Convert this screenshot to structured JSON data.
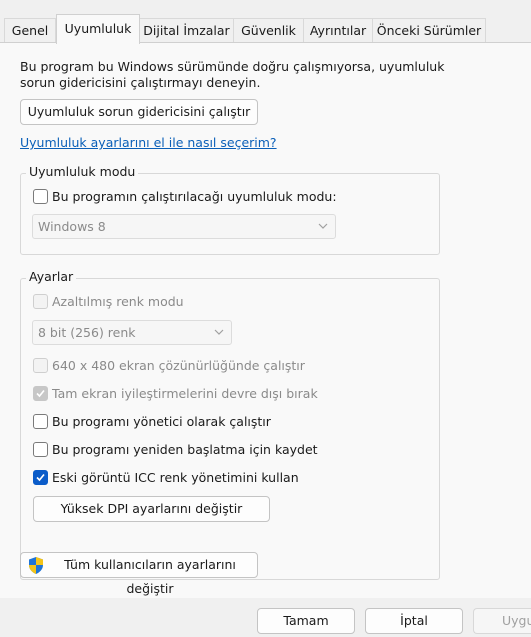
{
  "tabs": [
    {
      "label": "Genel"
    },
    {
      "label": "Uyumluluk"
    },
    {
      "label": "Dijital İmzalar"
    },
    {
      "label": "Güvenlik"
    },
    {
      "label": "Ayrıntılar"
    },
    {
      "label": "Önceki Sürümler"
    }
  ],
  "active_tab": "Uyumluluk",
  "description": "Bu program bu Windows sürümünde doğru çalışmıyorsa, uyumluluk sorun gidericisini çalıştırmayı deneyin.",
  "troubleshooter_button": "Uyumluluk sorun gidericisini çalıştır",
  "help_link": "Uyumluluk ayarlarını el ile nasıl seçerim?",
  "compat_mode": {
    "legend": "Uyumluluk modu",
    "checkbox_label": "Bu programın çalıştırılacağı uyumluluk modu:",
    "checked": false,
    "selected_os": "Windows 8"
  },
  "settings": {
    "legend": "Ayarlar",
    "reduced_color": {
      "label": "Azaltılmış renk modu",
      "checked": false,
      "enabled": false
    },
    "color_select": "8 bit (256) renk",
    "res_640": {
      "label": "640 x 480 ekran çözünürlüğünde çalıştır",
      "checked": false,
      "enabled": false
    },
    "fullscreen_opt": {
      "label": "Tam ekran iyileştirmelerini devre dışı bırak",
      "checked": true,
      "enabled": false
    },
    "run_admin": {
      "label": "Bu programı yönetici olarak çalıştır",
      "checked": false,
      "enabled": true
    },
    "register_restart": {
      "label": "Bu programı yeniden başlatma için kaydet",
      "checked": false,
      "enabled": true
    },
    "legacy_icc": {
      "label": "Eski görüntü ICC renk yönetimini kullan",
      "checked": true,
      "enabled": true
    },
    "dpi_button": "Yüksek DPI ayarlarını değiştir"
  },
  "all_users_button": "Tüm kullanıcıların ayarlarını değiştir",
  "footer": {
    "ok": "Tamam",
    "cancel": "İptal",
    "apply": "Uygula"
  }
}
